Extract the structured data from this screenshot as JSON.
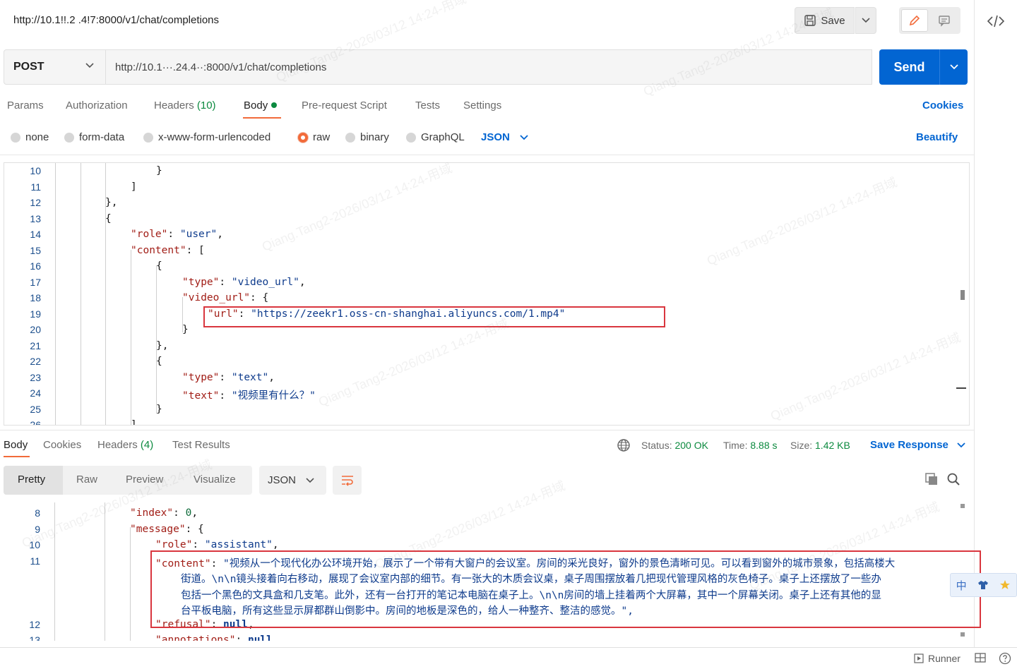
{
  "header": {
    "title": "http://10.1!!.2 .4!7:8000/v1/chat/completions",
    "save_label": "Save"
  },
  "request": {
    "method": "POST",
    "url": "http://10.1···.24.4··:8000/v1/chat/completions",
    "send_label": "Send"
  },
  "tabs": {
    "params": "Params",
    "authorization": "Authorization",
    "headers": "Headers",
    "headers_count": "(10)",
    "body": "Body",
    "prerequest": "Pre-request Script",
    "tests": "Tests",
    "settings": "Settings",
    "cookies": "Cookies"
  },
  "body_types": {
    "none": "none",
    "form_data": "form-data",
    "urlencoded": "x-www-form-urlencoded",
    "raw": "raw",
    "binary": "binary",
    "graphql": "GraphQL",
    "language": "JSON",
    "beautify": "Beautify"
  },
  "request_body": {
    "line_numbers": [
      "10",
      "11",
      "12",
      "13",
      "14",
      "15",
      "16",
      "17",
      "18",
      "19",
      "20",
      "21",
      "22",
      "23",
      "24",
      "25",
      "26"
    ],
    "role_key": "\"role\"",
    "role_val": "\"user\"",
    "content_key": "\"content\"",
    "type_key": "\"type\"",
    "type_video": "\"video_url\"",
    "video_url_key": "\"video_url\"",
    "url_key": "\"url\"",
    "url_val": "\"https://zeekr1.oss-cn-shanghai.aliyuncs.com/1.mp4\"",
    "type_text": "\"text\"",
    "text_key": "\"text\"",
    "text_val": "\"视频里有什么？\""
  },
  "response_tabs": {
    "body": "Body",
    "cookies": "Cookies",
    "headers": "Headers",
    "headers_count": "(4)",
    "test_results": "Test Results"
  },
  "response_meta": {
    "status_label": "Status:",
    "status_value": "200 OK",
    "time_label": "Time:",
    "time_value": "8.88 s",
    "size_label": "Size:",
    "size_value": "1.42 KB",
    "save_response": "Save Response"
  },
  "response_views": {
    "pretty": "Pretty",
    "raw": "Raw",
    "preview": "Preview",
    "visualize": "Visualize",
    "language": "JSON"
  },
  "response_body": {
    "line_numbers": [
      "8",
      "9",
      "10",
      "11",
      "",
      "",
      "",
      "",
      "12",
      "13"
    ],
    "index_key": "\"index\"",
    "index_val": "0",
    "message_key": "\"message\"",
    "role_key": "\"role\"",
    "role_val": "\"assistant\"",
    "content_key": "\"content\"",
    "content_line1": "\"视频从一个现代化办公环境开始，展示了一个带有大窗户的会议室。房间的采光良好，窗外的景色清晰可见。可以看到窗外的城市景象，包括高楼大",
    "content_line2": "街道。\\n\\n镜头接着向右移动，展现了会议室内部的细节。有一张大的木质会议桌，桌子周围摆放着几把现代管理风格的灰色椅子。桌子上还摆放了一些办",
    "content_line3": "包括一个黑色的文具盒和几支笔。此外，还有一台打开的笔记本电脑在桌子上。\\n\\n房间的墙上挂着两个大屏幕，其中一个屏幕关闭。桌子上还有其他的显",
    "content_line4": "台平板电脑，所有这些显示屏都群山倒影中。房间的地板是深色的，给人一种整齐、整洁的感觉。\",",
    "refusal_key": "\"refusal\"",
    "refusal_val": "null",
    "annotations_key": "\"annotations\"",
    "annotations_val": "null"
  },
  "ime": {
    "lang": "中"
  },
  "footer": {
    "runner": "Runner"
  },
  "watermark": "Qiang.Tang2-2026/03/12 14:24-用域",
  "colors": {
    "accent": "#0265d2",
    "tab_underline": "#f26b3a",
    "ok": "#0c8a3f",
    "highlight": "#d9363e"
  }
}
